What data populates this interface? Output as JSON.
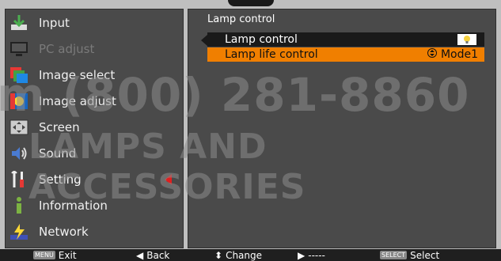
{
  "menu": {
    "items": [
      {
        "label": "Input",
        "icon": "input-icon",
        "state": "normal"
      },
      {
        "label": "PC adjust",
        "icon": "pc-adjust-icon",
        "state": "dim"
      },
      {
        "label": "Image select",
        "icon": "image-select-icon",
        "state": "normal"
      },
      {
        "label": "Image adjust",
        "icon": "image-adjust-icon",
        "state": "normal"
      },
      {
        "label": "Screen",
        "icon": "screen-icon",
        "state": "normal"
      },
      {
        "label": "Sound",
        "icon": "sound-icon",
        "state": "normal"
      },
      {
        "label": "Setting",
        "icon": "setting-icon",
        "state": "selected"
      },
      {
        "label": "Information",
        "icon": "information-icon",
        "state": "normal"
      },
      {
        "label": "Network",
        "icon": "network-icon",
        "state": "normal"
      }
    ]
  },
  "panel": {
    "title": "Lamp control",
    "rows": [
      {
        "label": "Lamp control",
        "value_icon": "bulb-icon"
      },
      {
        "label": "Lamp life control",
        "value": "Mode1"
      }
    ]
  },
  "watermark": {
    "line1": "m (800) 281-8860",
    "line2": "LAMPS AND ACCESSORIES"
  },
  "footer": {
    "exit_key": "MENU",
    "exit_label": "Exit",
    "back_label": "Back",
    "change_label": "Change",
    "next_label": "-----",
    "select_key": "SELECT",
    "select_label": "Select"
  },
  "colors": {
    "accent": "#f07f00",
    "selected_arrow": "#e11f1f",
    "panel": "#4a4a4a",
    "frame": "#bfbfbf"
  }
}
